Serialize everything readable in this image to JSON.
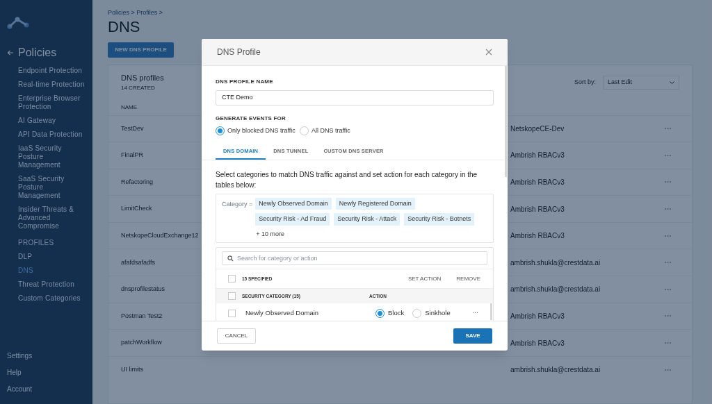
{
  "sidebar": {
    "back_title": "Policies",
    "items": [
      {
        "label": "Endpoint Protection",
        "kind": "item",
        "selected": false
      },
      {
        "label": "Real-time Protection",
        "kind": "item",
        "selected": false
      },
      {
        "label": "Enterprise Browser Protection",
        "kind": "item",
        "selected": false
      },
      {
        "label": "AI Gateway",
        "kind": "item",
        "selected": false
      },
      {
        "label": "API Data Protection",
        "kind": "item",
        "selected": false
      },
      {
        "label": "IaaS Security Posture Management",
        "kind": "item",
        "selected": false
      },
      {
        "label": "SaaS Security Posture Management",
        "kind": "item",
        "selected": false
      },
      {
        "label": "Insider Threats & Advanced Compromise",
        "kind": "item",
        "selected": false
      },
      {
        "label": "PROFILES",
        "kind": "heading",
        "selected": false
      },
      {
        "label": "DLP",
        "kind": "item",
        "selected": false
      },
      {
        "label": "DNS",
        "kind": "item",
        "selected": true
      },
      {
        "label": "Threat Protection",
        "kind": "item",
        "selected": false
      },
      {
        "label": "Custom Categories",
        "kind": "item",
        "selected": false
      }
    ],
    "footer": [
      "Settings",
      "Help",
      "Account"
    ]
  },
  "page": {
    "breadcrumb": "Policies > Profiles >",
    "title": "DNS",
    "new_button": "NEW DNS PROFILE",
    "card": {
      "title": "DNS profiles",
      "count": "14 CREATED",
      "sort_label": "Sort by:",
      "sort_value": "Last Edit"
    },
    "table": {
      "columns": [
        "NAME"
      ],
      "rows": [
        {
          "name": "TestDev",
          "edited": "NetskopeCE-Dev"
        },
        {
          "name": "FinalPR",
          "edited": "Ambrish RBACv3"
        },
        {
          "name": "Refactoring",
          "edited": "Ambrish RBACv3"
        },
        {
          "name": "LimitCheck",
          "edited": "Ambrish RBACv3"
        },
        {
          "name": "NetskopeCloudExchange12",
          "edited": "Ambrish RBACv3"
        },
        {
          "name": "afafdsafadfs",
          "edited": "ambrish.shukla@crestdata.ai"
        },
        {
          "name": "dnsprofilestatus",
          "edited": "ambrish.shukla@crestdata.ai"
        },
        {
          "name": "Postman Test2",
          "edited": "Ambrish RBACv3"
        },
        {
          "name": "patchWorkflow",
          "edited": "Ambrish RBACv3"
        },
        {
          "name": "UI limits",
          "edited": "ambrish.shukla@crestdata.ai"
        }
      ]
    }
  },
  "dialog": {
    "title": "DNS Profile",
    "name_label": "DNS PROFILE NAME",
    "name_value": "CTE Demo",
    "events_label": "GENERATE EVENTS FOR",
    "events_options": [
      {
        "label": "Only blocked DNS traffic",
        "selected": true
      },
      {
        "label": "All DNS traffic",
        "selected": false
      }
    ],
    "tabs": [
      {
        "label": "DNS DOMAIN",
        "selected": true
      },
      {
        "label": "DNS TUNNEL",
        "selected": false
      },
      {
        "label": "CUSTOM DNS SERVER",
        "selected": false
      }
    ],
    "description": "Select categories to match DNS traffic against and set action for each category in the tables below:",
    "category_label": "Category =",
    "category_tags": [
      "Newly Observed Domain",
      "Newly Registered Domain",
      "Security Risk - Ad Fraud",
      "Security Risk - Attack",
      "Security Risk - Botnets"
    ],
    "more": "+ 10 more",
    "search_placeholder": "Search for category or action",
    "select_all_checked": false,
    "header_checked": false,
    "specified": "15 SPECIFIED",
    "set_action": "SET ACTION",
    "remove": "REMOVE",
    "columns": [
      "SECURITY CATEGORY (15)",
      "ACTION"
    ],
    "rows": [
      {
        "category": "Newly Observed Domain",
        "checked": false,
        "actions": [
          {
            "label": "Block",
            "selected": true
          },
          {
            "label": "Sinkhole",
            "selected": false
          }
        ],
        "menu": "···"
      }
    ],
    "cancel": "CANCEL",
    "save": "SAVE"
  }
}
